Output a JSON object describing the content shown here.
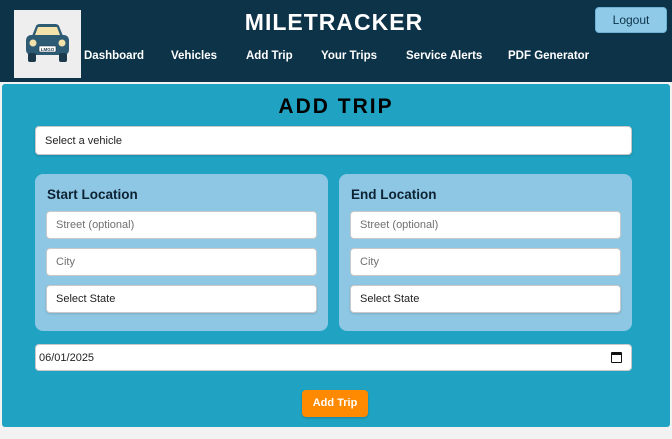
{
  "header": {
    "title": "MILETRACKER",
    "logo_plate_text": "LMGO",
    "logout_label": "Logout",
    "nav": [
      {
        "label": "Dashboard"
      },
      {
        "label": "Vehicles"
      },
      {
        "label": "Add Trip"
      },
      {
        "label": "Your Trips"
      },
      {
        "label": "Service Alerts"
      },
      {
        "label": "PDF Generator"
      }
    ]
  },
  "form": {
    "title": "ADD TRIP",
    "vehicle_select": "Select a vehicle",
    "start": {
      "heading": "Start Location",
      "street_placeholder": "Street (optional)",
      "city_placeholder": "City",
      "state_select": "Select State"
    },
    "end": {
      "heading": "End Location",
      "street_placeholder": "Street (optional)",
      "city_placeholder": "City",
      "state_select": "Select State"
    },
    "date_value": "06/01/2025",
    "submit_label": "Add Trip"
  },
  "colors": {
    "header_bg": "#0d3349",
    "panel_bg": "#20a2c2",
    "card_bg": "#8ec7e4",
    "accent_button": "#ff8a00",
    "logout_bg": "#8fcbe8"
  },
  "icons": {
    "logo": "car-logo-icon",
    "date": "calendar-icon"
  }
}
